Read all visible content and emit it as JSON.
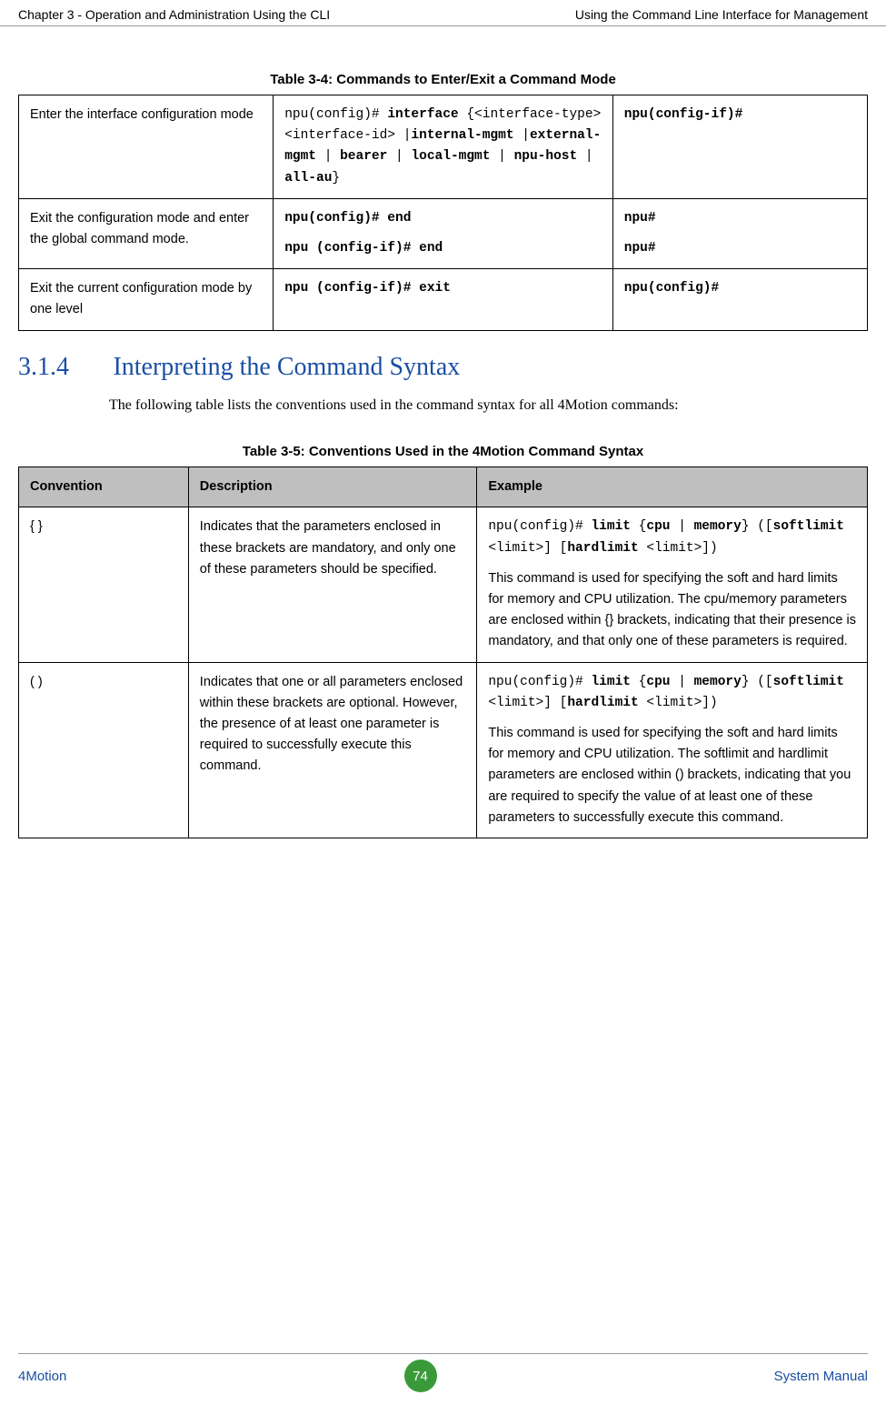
{
  "header": {
    "left": "Chapter 3 - Operation and Administration Using the CLI",
    "right": "Using the Command Line Interface for Management"
  },
  "table34": {
    "title": "Table 3-4: Commands to Enter/Exit a Command Mode",
    "rows": [
      {
        "desc": "Enter the interface configuration mode",
        "cmd_pre": "npu(config)# ",
        "cmd_bold1": "interface",
        "cmd_mid1": " {<interface-type> <interface-id> |",
        "cmd_bold2": "internal-mgmt",
        "cmd_mid2": " |",
        "cmd_bold3": "external-mgmt",
        "cmd_mid3": " | ",
        "cmd_bold4": "bearer",
        "cmd_mid4": " | ",
        "cmd_bold5": "local-mgmt",
        "cmd_mid5": " | ",
        "cmd_bold6": "npu-host",
        "cmd_mid6": " | ",
        "cmd_bold7": "all-au",
        "cmd_end": "}",
        "prompt": "npu(config-if)#"
      },
      {
        "desc": "Exit the configuration mode and enter the global command mode.",
        "cmd1": "npu(config)# end",
        "cmd2": "npu (config-if)# end",
        "prompt1": "npu#",
        "prompt2": "npu#"
      },
      {
        "desc": "Exit the current configuration mode by one level",
        "cmd": "npu (config-if)# exit",
        "prompt": "npu(config)#"
      }
    ]
  },
  "section": {
    "num": "3.1.4",
    "title": "Interpreting the Command Syntax",
    "body": "The following table lists the conventions used in the command syntax for all 4Motion commands:"
  },
  "table35": {
    "title": "Table 3-5: Conventions Used in the 4Motion Command Syntax",
    "headers": {
      "c1": "Convention",
      "c2": "Description",
      "c3": "Example"
    },
    "rows": [
      {
        "conv": "{ }",
        "desc": "Indicates that the parameters enclosed in these brackets are mandatory, and only one of these parameters should be specified.",
        "ex_p1": "npu(config)# ",
        "ex_b1": "limit",
        "ex_p2": " {",
        "ex_b2": "cpu",
        "ex_p3": " | ",
        "ex_b3": "memory",
        "ex_p4": "} ([",
        "ex_b4": "softlimit",
        "ex_p5": " <limit>]  [",
        "ex_b5": "hardlimit",
        "ex_p6": " <limit>])",
        "ex_text": "This command is used for specifying the soft and hard limits for memory and CPU utilization. The cpu/memory parameters are enclosed within {} brackets, indicating that their presence is mandatory, and that only one of these parameters is required."
      },
      {
        "conv": "( )",
        "desc": "Indicates that one or all parameters enclosed within these brackets are optional. However, the presence of at least one parameter is required to successfully execute this command.",
        "ex_p1": "npu(config)# ",
        "ex_b1": "limit",
        "ex_p2": " {",
        "ex_b2": "cpu",
        "ex_p3": " | ",
        "ex_b3": "memory",
        "ex_p4": "} ([",
        "ex_b4": "softlimit",
        "ex_p5": " <limit>]  [",
        "ex_b5": "hardlimit",
        "ex_p6": " <limit>])",
        "ex_text": "This command is used for specifying the soft and hard limits for memory and CPU utilization. The softlimit and hardlimit parameters are enclosed within () brackets, indicating that you are required to specify the value of at least one of these parameters to successfully execute this command."
      }
    ]
  },
  "footer": {
    "left": "4Motion",
    "page": "74",
    "right": "System Manual"
  }
}
